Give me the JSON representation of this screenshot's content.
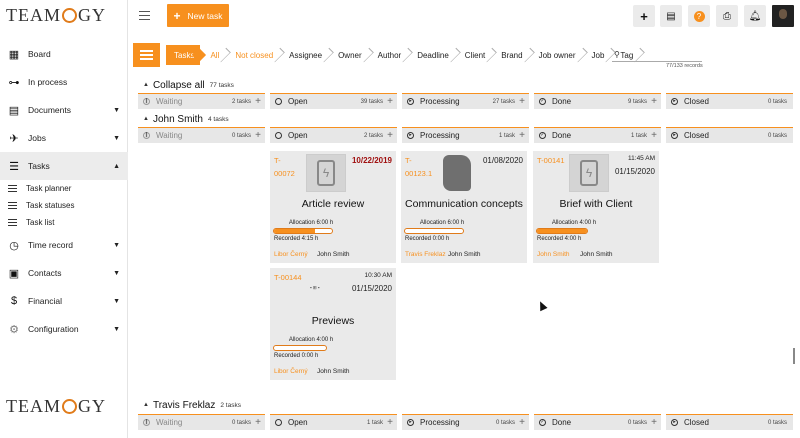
{
  "app": {
    "logo_text_left": "TEAM",
    "logo_text_right": "GY"
  },
  "sidebar": {
    "items": [
      {
        "label": "Board",
        "icon": "grid-icon",
        "caret": ""
      },
      {
        "label": "In process",
        "icon": "flow-icon",
        "caret": ""
      },
      {
        "label": "Documents",
        "icon": "document-icon",
        "caret": "▼"
      },
      {
        "label": "Jobs",
        "icon": "rocket-icon",
        "caret": "▼"
      },
      {
        "label": "Tasks",
        "icon": "list-icon",
        "caret": "▲"
      },
      {
        "label": "Time record",
        "icon": "clock-icon",
        "caret": "▼"
      },
      {
        "label": "Contacts",
        "icon": "contacts-icon",
        "caret": "▼"
      },
      {
        "label": "Financial",
        "icon": "dollar-icon",
        "caret": "▼"
      },
      {
        "label": "Configuration",
        "icon": "gear-icon",
        "caret": "▼"
      }
    ],
    "sub_items": [
      "Task planner",
      "Task statuses",
      "Task list"
    ]
  },
  "topbar": {
    "new_task_label": "New task",
    "new_task_plus": "+"
  },
  "filters": {
    "chips": [
      "Tasks",
      "All",
      "Not closed",
      "Assignee",
      "Owner",
      "Author",
      "Deadline",
      "Client",
      "Brand",
      "Job owner",
      "Job",
      "Tag"
    ],
    "search_placeholder": "",
    "records": "77/133 records"
  },
  "groups": [
    {
      "name": "Collapse all",
      "count": "77 tasks",
      "arrow": "▲"
    },
    {
      "name": "John Smith",
      "count": "4 tasks",
      "arrow": "▲"
    },
    {
      "name": "Travis Freklaz",
      "count": "2 tasks",
      "arrow": "▲"
    }
  ],
  "columns": {
    "collapse": [
      {
        "label": "Waiting",
        "count": "2 tasks",
        "icon": "pause-icon"
      },
      {
        "label": "Open",
        "count": "39 tasks",
        "icon": "circle-icon"
      },
      {
        "label": "Processing",
        "count": "27 tasks",
        "icon": "play-icon"
      },
      {
        "label": "Done",
        "count": "9 tasks",
        "icon": "check-icon"
      },
      {
        "label": "Closed",
        "count": "0 tasks",
        "icon": "play-icon"
      }
    ],
    "john": [
      {
        "label": "Waiting",
        "count": "0 tasks",
        "icon": "pause-icon"
      },
      {
        "label": "Open",
        "count": "2 tasks",
        "icon": "circle-icon"
      },
      {
        "label": "Processing",
        "count": "1 task",
        "icon": "play-icon"
      },
      {
        "label": "Done",
        "count": "1 task",
        "icon": "check-icon"
      },
      {
        "label": "Closed",
        "count": "0 tasks",
        "icon": "play-icon"
      }
    ],
    "travis": [
      {
        "label": "Waiting",
        "count": "0 tasks",
        "icon": "pause-icon"
      },
      {
        "label": "Open",
        "count": "1 task",
        "icon": "circle-icon"
      },
      {
        "label": "Processing",
        "count": "0 tasks",
        "icon": "play-icon"
      },
      {
        "label": "Done",
        "count": "0 tasks",
        "icon": "check-icon"
      },
      {
        "label": "Closed",
        "count": "0 tasks",
        "icon": "play-icon"
      }
    ]
  },
  "cards": [
    {
      "id_line1": "T-",
      "id_line2": "00072",
      "time": "",
      "date": "10/22/2019",
      "title": "Article review",
      "allocation": "Allocation 6:00 h",
      "recorded": "Recorded 4:15 h",
      "progress": 0.71,
      "owner": "Libor Černý",
      "assignee": "John Smith"
    },
    {
      "id_line1": "T-",
      "id_line2": "00123.1",
      "time": "",
      "date": "01/08/2020",
      "title": "Communication concepts",
      "allocation": "Allocation 6:00 h",
      "recorded": "Recorded 0:00 h",
      "progress": 0.0,
      "owner": "Travis Freklaz",
      "assignee": "John Smith"
    },
    {
      "id_line1": "T-00141",
      "id_line2": "",
      "time": "11:45 AM",
      "date": "01/15/2020",
      "title": "Brief with Client",
      "allocation": "Allocation 4:00 h",
      "recorded": "Recorded 4:00 h",
      "progress": 1.0,
      "owner": "John Smith",
      "assignee": "John Smith"
    },
    {
      "id_line1": "T-00144",
      "id_line2": "",
      "time": "10:30 AM",
      "date": "01/15/2020",
      "title": "Previews",
      "allocation": "Allocation 4:00 h",
      "recorded": "Recorded 0:00 h",
      "progress": 0.0,
      "owner": "Libor Černý",
      "assignee": "John Smith"
    }
  ],
  "colors": {
    "accent": "#f7901e",
    "overdue": "#a01010"
  }
}
